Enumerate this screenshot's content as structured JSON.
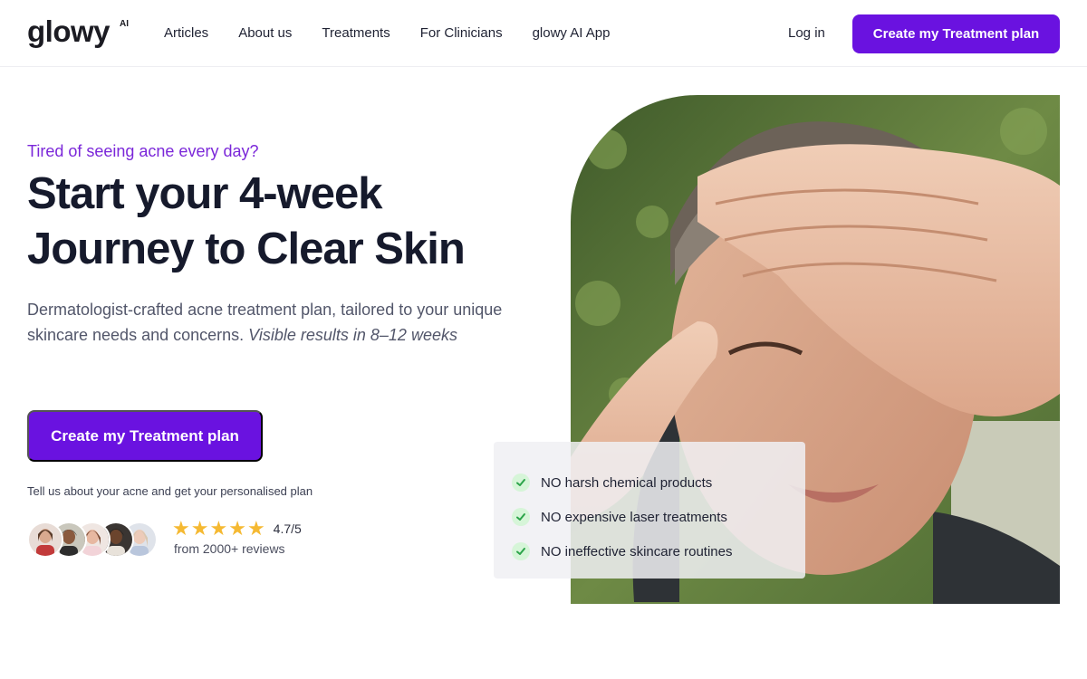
{
  "header": {
    "logo": "glowy",
    "logo_suffix": "AI",
    "nav": [
      "Articles",
      "About us",
      "Treatments",
      "For Clinicians",
      "glowy AI App"
    ],
    "login": "Log in",
    "cta": "Create my Treatment plan"
  },
  "hero": {
    "eyebrow": "Tired of seeing acne every day?",
    "headline_line1": "Start your 4-week",
    "headline_line2": "Journey to Clear Skin",
    "description": "Dermatologist-crafted acne treatment plan, tailored to your unique skincare needs and concerns.",
    "description_emphasis": "Visible results in 8–12 weeks",
    "cta": "Create my Treatment plan",
    "subtext": "Tell us about your acne and get your personalised plan",
    "rating": "4.7/5",
    "rating_stars": 5,
    "reviews": "from 2000+ reviews"
  },
  "checklist": [
    "NO harsh chemical products",
    "NO expensive laser treatments",
    "NO ineffective skincare routines"
  ],
  "colors": {
    "accent": "#6a12e0",
    "eyebrow": "#7b27d9",
    "star": "#f5b932",
    "check_bg": "#d6f5d8",
    "check_icon": "#2ca44a"
  }
}
